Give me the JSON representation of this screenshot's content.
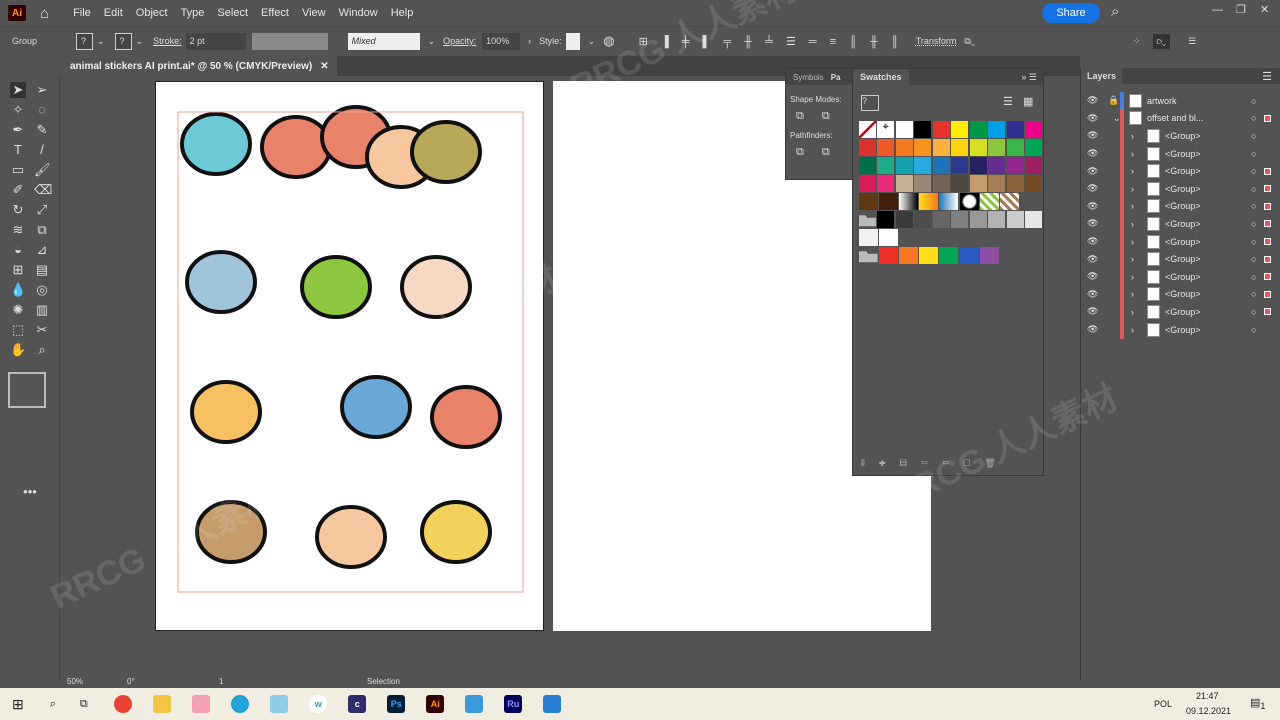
{
  "app": {
    "logo": "Ai",
    "menu": [
      "File",
      "Edit",
      "Object",
      "Type",
      "Select",
      "Effect",
      "View",
      "Window",
      "Help"
    ],
    "share": "Share"
  },
  "control": {
    "selection_type": "Group",
    "stroke_label": "Stroke:",
    "stroke_value": "2 pt",
    "brush": "Mixed",
    "opacity_label": "Opacity:",
    "opacity_value": "100%",
    "style_label": "Style:",
    "transform_label": "Transform"
  },
  "document_tab": {
    "title": "animal stickers AI print.ai* @ 50 % (CMYK/Preview)"
  },
  "pathfinder": {
    "tabs": [
      "Symbols",
      "Pa"
    ],
    "shape_modes": "Shape Modes:",
    "pathfinders": "Pathfinders:"
  },
  "swatches": {
    "title": "Swatches",
    "rows": [
      [
        "none",
        "registration",
        "#ffffff",
        "#000000",
        "#e8332a",
        "#ffed00",
        "#009a44",
        "#00a0e9",
        "#2e3192",
        "#ec008c"
      ],
      [
        "#d9342b",
        "#ef5a2a",
        "#f47920",
        "#f7941d",
        "#fbb040",
        "#fdd20f",
        "#d7df23",
        "#8dc63f",
        "#39b54a",
        "#00a651"
      ],
      [
        "#00704a",
        "#1fab89",
        "#16a3ad",
        "#27aae1",
        "#1c75bc",
        "#2b3990",
        "#262262",
        "#662d91",
        "#92278f",
        "#9e1f63"
      ],
      [
        "#da1c5c",
        "#ee2a7b",
        "#c7b299",
        "#998675",
        "#736357",
        "#534741",
        "#c69c6d",
        "#a67c52",
        "#8c6239",
        "#754c24"
      ],
      [
        "#603913",
        "#42210b",
        "grad-bw",
        "grad-orange",
        "grad-blue",
        "radial",
        "pattern-green",
        "pattern-brown"
      ],
      [
        "folder",
        "#000000",
        "#3c3c3c",
        "#4d4d4d",
        "#666666",
        "#808080",
        "#999999",
        "#b3b3b3",
        "#cccccc",
        "#e6e6e6"
      ],
      [
        "#f2f2f2",
        "#ffffff"
      ],
      [
        "folder",
        "#ee3124",
        "#f47920",
        "#ffde17",
        "#00a651",
        "#2b59c3",
        "#8e4fa3"
      ]
    ]
  },
  "layers": {
    "title": "Layers",
    "items": [
      {
        "name": "artwork",
        "level": 0,
        "expanded": false,
        "locked": true,
        "color": "#4a7fd8"
      },
      {
        "name": "offset and bl...",
        "level": 0,
        "expanded": true,
        "locked": false,
        "color": "#e05a5a",
        "selected": true
      },
      {
        "name": "<Group>",
        "level": 1,
        "selected": false
      },
      {
        "name": "<Group>",
        "level": 1,
        "selected": false
      },
      {
        "name": "<Group>",
        "level": 1,
        "selected": true
      },
      {
        "name": "<Group>",
        "level": 1,
        "selected": true
      },
      {
        "name": "<Group>",
        "level": 1,
        "selected": true
      },
      {
        "name": "<Group>",
        "level": 1,
        "selected": true
      },
      {
        "name": "<Group>",
        "level": 1,
        "selected": true
      },
      {
        "name": "<Group>",
        "level": 1,
        "selected": true
      },
      {
        "name": "<Group>",
        "level": 1,
        "selected": true
      },
      {
        "name": "<Group>",
        "level": 1,
        "selected": true
      },
      {
        "name": "<Group>",
        "level": 1,
        "selected": true
      },
      {
        "name": "<Group>",
        "level": 1,
        "selected": false
      }
    ]
  },
  "status": {
    "zoom": "50%",
    "rotation": "0°",
    "artboard": "1",
    "tool": "Selection"
  },
  "taskbar": {
    "lang": "POL",
    "time": "21:47",
    "date": "09.12.2021",
    "notifications": "1"
  },
  "watermark": "RRCG 人人素材"
}
